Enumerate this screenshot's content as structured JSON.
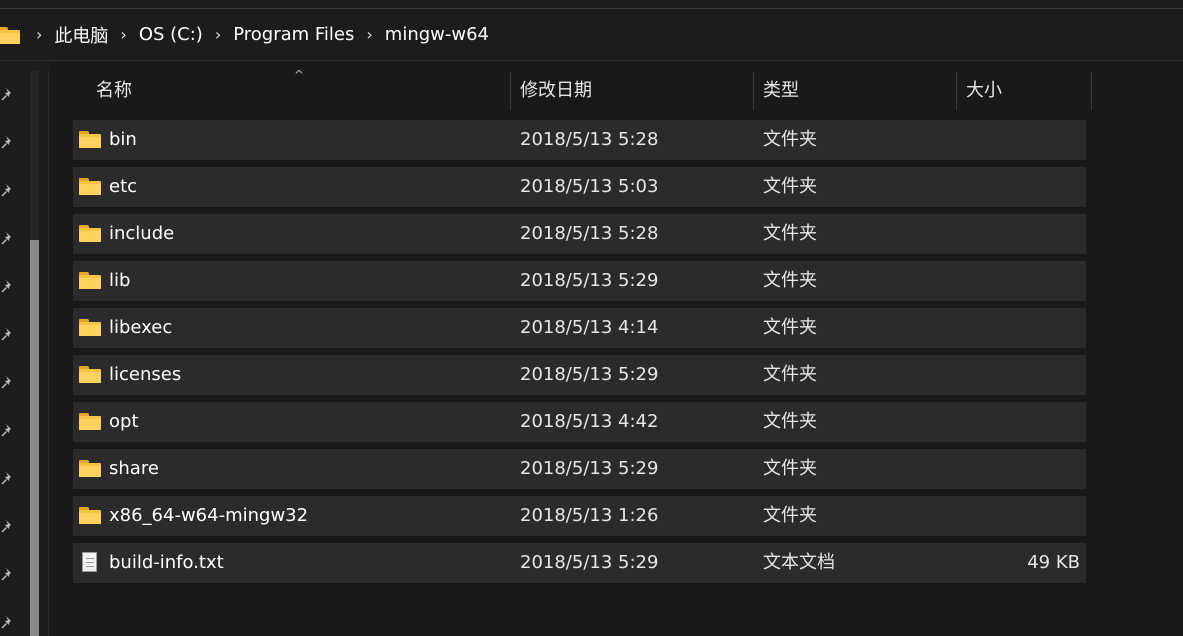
{
  "breadcrumb": {
    "folder_icon": "folder-icon",
    "separator": "›",
    "items": [
      "此电脑",
      "OS (C:)",
      "Program Files",
      "mingw-w64"
    ]
  },
  "columns": {
    "name": "名称",
    "date": "修改日期",
    "type": "类型",
    "size": "大小",
    "sort_indicator": "^"
  },
  "files": [
    {
      "name": "bin",
      "date": "2018/5/13 5:28",
      "type": "文件夹",
      "size": "",
      "icon": "folder-icon"
    },
    {
      "name": "etc",
      "date": "2018/5/13 5:03",
      "type": "文件夹",
      "size": "",
      "icon": "folder-icon"
    },
    {
      "name": "include",
      "date": "2018/5/13 5:28",
      "type": "文件夹",
      "size": "",
      "icon": "folder-icon"
    },
    {
      "name": "lib",
      "date": "2018/5/13 5:29",
      "type": "文件夹",
      "size": "",
      "icon": "folder-icon"
    },
    {
      "name": "libexec",
      "date": "2018/5/13 4:14",
      "type": "文件夹",
      "size": "",
      "icon": "folder-icon"
    },
    {
      "name": "licenses",
      "date": "2018/5/13 5:29",
      "type": "文件夹",
      "size": "",
      "icon": "folder-icon"
    },
    {
      "name": "opt",
      "date": "2018/5/13 4:42",
      "type": "文件夹",
      "size": "",
      "icon": "folder-icon"
    },
    {
      "name": "share",
      "date": "2018/5/13 5:29",
      "type": "文件夹",
      "size": "",
      "icon": "folder-icon"
    },
    {
      "name": "x86_64-w64-mingw32",
      "date": "2018/5/13 1:26",
      "type": "文件夹",
      "size": "",
      "icon": "folder-icon"
    },
    {
      "name": "build-info.txt",
      "date": "2018/5/13 5:29",
      "type": "文本文档",
      "size": "49 KB",
      "icon": "text-file-icon"
    }
  ],
  "pins": [
    "pin-icon",
    "pin-icon",
    "pin-icon",
    "pin-icon",
    "pin-icon",
    "pin-icon",
    "pin-icon",
    "pin-icon",
    "pin-icon",
    "pin-icon",
    "pin-icon",
    "pin-icon"
  ],
  "colors": {
    "background": "#191919",
    "row": "#2b2b2b",
    "folder": "#f5c242"
  }
}
